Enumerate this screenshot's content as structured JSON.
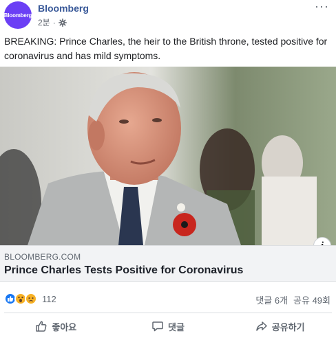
{
  "post": {
    "page_name": "Bloomberg",
    "avatar_text": "Bloomberg",
    "time": "2분",
    "privacy_icon": "gear-icon",
    "text": "BREAKING: Prince Charles, the heir to the British throne, tested positive for coronavirus and has mild symptoms."
  },
  "link": {
    "domain": "BLOOMBERG.COM",
    "title": "Prince Charles Tests Positive for Coronavirus",
    "info_label": "i"
  },
  "engagement": {
    "reaction_count": "112",
    "comments": "댓글 6개",
    "shares": "공유 49회"
  },
  "actions": {
    "like": "좋아요",
    "comment": "댓글",
    "share": "공유하기"
  },
  "colors": {
    "brand": "#385898",
    "avatar_bg": "#6b3ff5",
    "like_blue": "#1877f2",
    "emoji_yellow": "#f7b125"
  }
}
